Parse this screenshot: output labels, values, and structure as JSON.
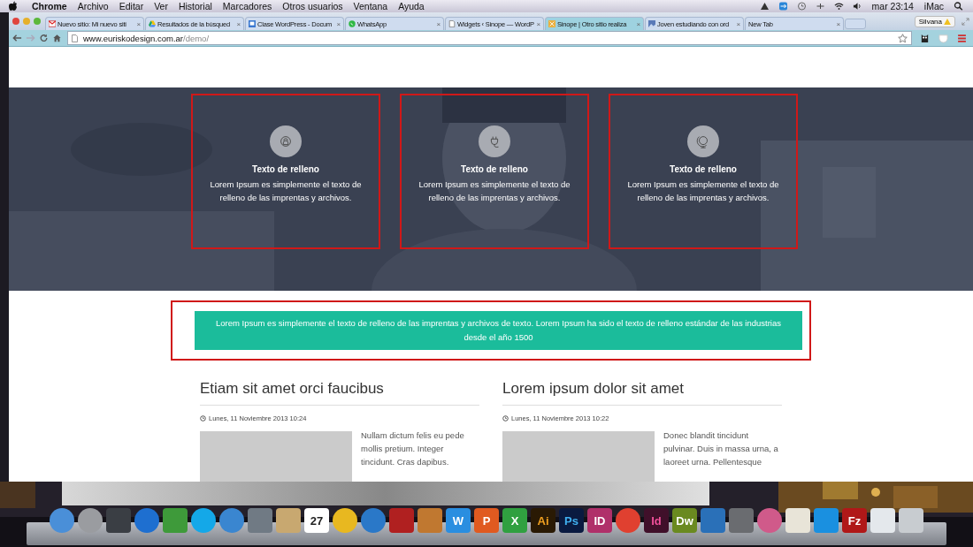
{
  "menu_bar": {
    "app": "Chrome",
    "items": [
      "Archivo",
      "Editar",
      "Ver",
      "Historial",
      "Marcadores",
      "Otros usuarios",
      "Ventana",
      "Ayuda"
    ],
    "clock": "mar 23:14",
    "computer": "iMac"
  },
  "tabs": [
    {
      "title": "Nuevo sitio: Mi nuevo siti",
      "kind": "mail",
      "close": "×",
      "selected": false
    },
    {
      "title": "Resultados de la búsqued",
      "kind": "drive",
      "close": "×",
      "selected": false
    },
    {
      "title": "Clase WordPress - Docum",
      "kind": "doc",
      "close": "×",
      "selected": false
    },
    {
      "title": "WhatsApp",
      "kind": "chat",
      "close": "×",
      "selected": false
    },
    {
      "title": "Widgets ‹ Sinope — WordP",
      "kind": "page",
      "close": "×",
      "selected": false
    },
    {
      "title": "Sinope | Otro sitio realiza",
      "kind": "site",
      "close": "×",
      "selected": true
    },
    {
      "title": "Joven estudiando con ord",
      "close": "×",
      "selected": false
    },
    {
      "title": "New Tab",
      "kind": "blank",
      "close": "×",
      "selected": false
    }
  ],
  "profile": {
    "name": "Silvana"
  },
  "address_bar": {
    "host": "www.euriskodesign.com.ar",
    "path": "/demo/"
  },
  "page": {
    "features": [
      {
        "kind": "headset",
        "title": "Texto de relleno",
        "text": "Lorem Ipsum es simplemente el texto de relleno de las imprentas y archivos."
      },
      {
        "kind": "plug",
        "title": "Texto de relleno",
        "text": "Lorem Ipsum es simplemente el texto de relleno de las imprentas y archivos."
      },
      {
        "kind": "globe",
        "title": "Texto de relleno",
        "text": "Lorem Ipsum es simplemente el texto de relleno de las imprentas y archivos."
      }
    ],
    "banner": "Lorem Ipsum es simplemente el texto de relleno de las imprentas y archivos de texto. Lorem Ipsum ha sido el texto de relleno estándar de las industrias desde el año 1500",
    "posts": [
      {
        "title": "Etiam sit amet orci faucibus",
        "date": "Lunes, 11 Noviembre 2013 10:24",
        "excerpt": "Nullam dictum felis eu pede mollis pretium. Integer tincidunt. Cras dapibus."
      },
      {
        "title": "Lorem ipsum dolor sit amet",
        "date": "Lunes, 11 Noviembre 2013 10:22",
        "excerpt": "Donec blandit tincidunt pulvinar. Duis in massa urna, a laoreet urna. Pellentesque"
      }
    ]
  },
  "dock": [
    {
      "kind": "round",
      "color": "#4a8fd8"
    },
    {
      "kind": "round",
      "color": "#9a9ca0"
    },
    {
      "kind": "square",
      "color": "#3a3e44"
    },
    {
      "kind": "round",
      "color": "#1e6fd0"
    },
    {
      "kind": "square",
      "color": "#3e9a3a"
    },
    {
      "kind": "round",
      "color": "#14a8e8"
    },
    {
      "kind": "round",
      "color": "#3a86d0"
    },
    {
      "kind": "square",
      "color": "#707a84"
    },
    {
      "kind": "square",
      "color": "#c8a870"
    },
    {
      "kind": "glyph",
      "color": "#ffffff",
      "text": "27"
    },
    {
      "kind": "round",
      "color": "#e8b820"
    },
    {
      "kind": "round",
      "color": "#2a78c8"
    },
    {
      "kind": "square",
      "color": "#b02020"
    },
    {
      "kind": "square",
      "color": "#c07830"
    },
    {
      "kind": "glyph",
      "color": "#2a8ee0",
      "text": "W"
    },
    {
      "kind": "glyph",
      "color": "#e05a20",
      "text": "P"
    },
    {
      "kind": "glyph",
      "color": "#30a040",
      "text": "X"
    },
    {
      "kind": "glyph",
      "color": "#2a1a04",
      "text": "Ai"
    },
    {
      "kind": "glyph",
      "color": "#0a1a40",
      "text": "Ps"
    },
    {
      "kind": "glyph",
      "color": "#b0306a",
      "text": "ID"
    },
    {
      "kind": "round",
      "color": "#e04030"
    },
    {
      "kind": "glyph",
      "color": "#40102a",
      "text": "Id"
    },
    {
      "kind": "glyph",
      "color": "#6a8a20",
      "text": "Dw"
    },
    {
      "kind": "square",
      "color": "#2a70b8"
    },
    {
      "kind": "square",
      "color": "#6a6c70"
    },
    {
      "kind": "round",
      "color": "#d05a8a"
    },
    {
      "kind": "square",
      "color": "#e8e4d8"
    },
    {
      "kind": "square",
      "color": "#1a90e0"
    },
    {
      "kind": "glyph",
      "color": "#b01818",
      "text": "Fz"
    },
    {
      "kind": "square",
      "color": "#e4e8ec"
    },
    {
      "kind": "square",
      "color": "#c8ccd0"
    }
  ]
}
